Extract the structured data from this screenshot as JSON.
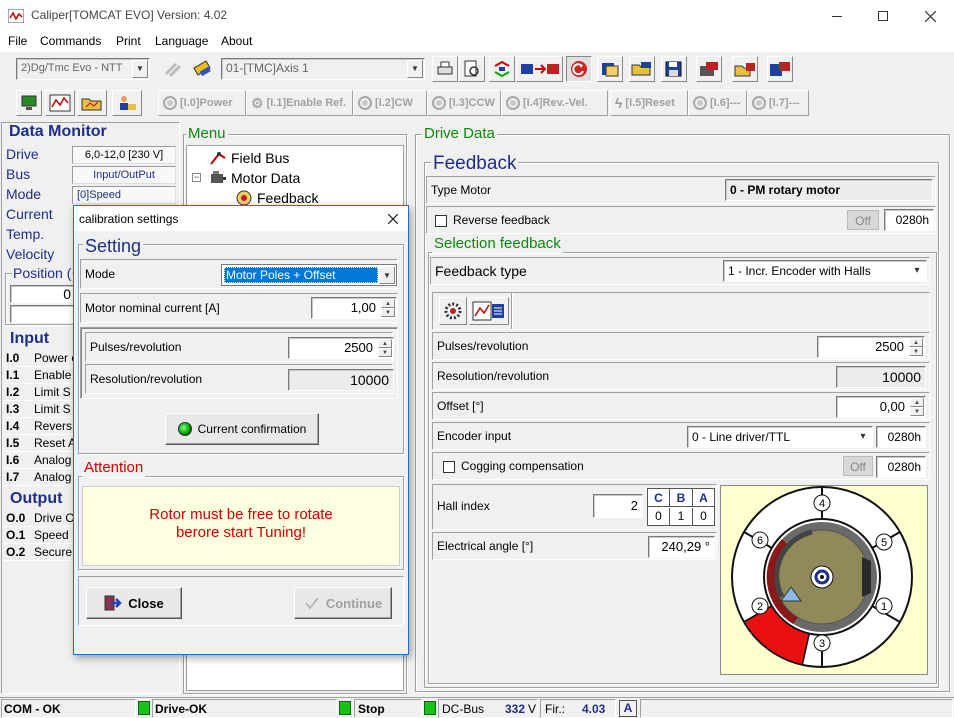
{
  "window": {
    "title": "Caliper[TOMCAT EVO] Version: 4.02",
    "menu": [
      "File",
      "Commands",
      "Print",
      "Language",
      "About"
    ]
  },
  "toolbar": {
    "drive_select": "2)Dg/Tmc Evo - NTT",
    "axis_select": "01-[TMC]Axis 1",
    "inputs": [
      "[I.0]Power",
      "[I.1]Enable Ref.",
      "[I.2]CW",
      "[I.3]CCW",
      "[I.4]Rev.-Vel.",
      "[I.5]Reset",
      "[I.6]---",
      "[I.7]---"
    ]
  },
  "monitor": {
    "title": "Data Monitor",
    "rows": [
      {
        "label": "Drive",
        "value": "6,0-12,0 [230 V]"
      },
      {
        "label": "Bus",
        "value": "Input/OutPut"
      },
      {
        "label": "Mode",
        "value": "[0]Speed"
      },
      {
        "label": "Current",
        "value": ""
      },
      {
        "label": "Temp.",
        "value": ""
      },
      {
        "label": "Velocity",
        "value": ""
      }
    ],
    "position_label": "Position (",
    "position_value": "0",
    "input_title": "Input",
    "inputs": [
      {
        "id": "I.0",
        "label": "Power o"
      },
      {
        "id": "I.1",
        "label": "Enable"
      },
      {
        "id": "I.2",
        "label": "Limit S"
      },
      {
        "id": "I.3",
        "label": "Limit S"
      },
      {
        "id": "I.4",
        "label": "Revers"
      },
      {
        "id": "I.5",
        "label": "Reset A"
      },
      {
        "id": "I.6",
        "label": "Analog"
      },
      {
        "id": "I.7",
        "label": "Analog"
      }
    ],
    "output_title": "Output",
    "outputs": [
      {
        "id": "O.0",
        "label": "Drive O"
      },
      {
        "id": "O.1",
        "label": "Speed"
      },
      {
        "id": "O.2",
        "label": "Secure"
      }
    ]
  },
  "menu_tree": {
    "title": "Menu",
    "items": [
      "Field Bus",
      "Motor Data",
      "Feedback"
    ]
  },
  "drive_data": {
    "title": "Drive Data",
    "feedback_title": "Feedback",
    "type_motor_label": "Type Motor",
    "type_motor_value": "0 - PM rotary motor",
    "reverse_label": "Reverse feedback",
    "reverse_state": "Off",
    "reverse_code": "0280h",
    "selection_title": "Selection feedback",
    "feedback_type_label": "Feedback type",
    "feedback_type_value": "1 - Incr. Encoder with Halls",
    "pulses_label": "Pulses/revolution",
    "pulses_value": "2500",
    "resolution_label": "Resolution/revolution",
    "resolution_value": "10000",
    "offset_label": "Offset [°]",
    "offset_value": "0,00",
    "encoder_label": "Encoder input",
    "encoder_value": "0 - Line driver/TTL",
    "encoder_code": "0280h",
    "cogging_label": "Cogging compensation",
    "cogging_state": "Off",
    "cogging_code": "0280h",
    "hall_label": "Hall index",
    "hall_value": "2",
    "hall_headers": [
      "C",
      "B",
      "A"
    ],
    "hall_bits": [
      "0",
      "1",
      "0"
    ],
    "angle_label": "Electrical angle [°]",
    "angle_value": "240,29 °",
    "hall_sectors": [
      "1",
      "2",
      "3",
      "4",
      "5",
      "6"
    ]
  },
  "dialog": {
    "title": "calibration settings",
    "setting_title": "Setting",
    "mode_label": "Mode",
    "mode_value": "Motor Poles + Offset",
    "current_label": "Motor nominal current [A]",
    "current_value": "1,00",
    "pulses_label": "Pulses/revolution",
    "pulses_value": "2500",
    "resolution_label": "Resolution/revolution",
    "resolution_value": "10000",
    "confirm_label": "Current confirmation",
    "attention_title": "Attention",
    "attention_line1": "Rotor must be free to rotate",
    "attention_line2": "berore start Tuning!",
    "close_label": "Close",
    "continue_label": "Continue"
  },
  "status": {
    "com": "COM - OK",
    "drive": "Drive-OK",
    "stop": "Stop",
    "dcbus_label": "DC-Bus",
    "dcbus_value": "332",
    "dcbus_unit": "V",
    "fir_label": "Fir.:",
    "fir_value": "4.03",
    "mode": "A"
  },
  "colors": {
    "accent_blue": "#1e2f8a",
    "group_green": "#0a8a0a",
    "attention_red": "#d00000",
    "active_led": "#19c119",
    "selection": "#0078d7"
  }
}
